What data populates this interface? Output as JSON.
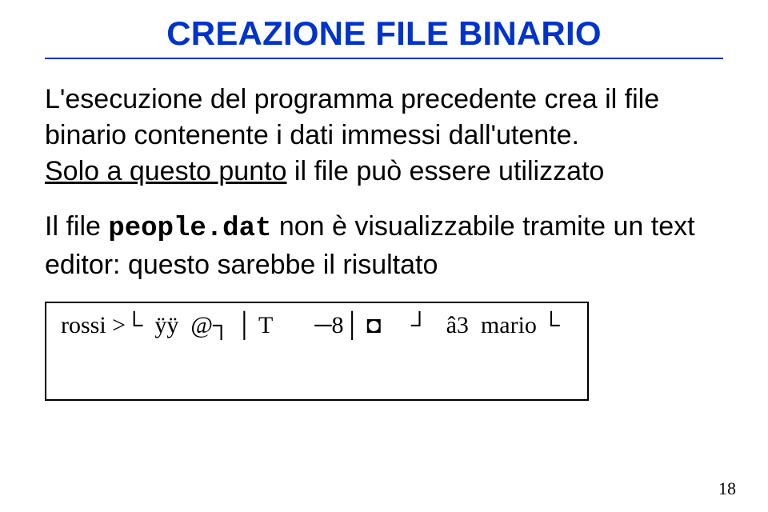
{
  "title": "CREAZIONE FILE BINARIO",
  "p1_a": "L'esecuzione del programma precedente crea il file binario contenente i dati immessi dall'utente. ",
  "p1_u": "Solo a questo punto",
  "p1_b": " il file può essere utilizzato",
  "p2_a": "Il file ",
  "p2_code": "people.dat",
  "p2_b": " non è visualizzabile tramite un text editor: questo sarebbe il risultato",
  "hex": "rossi >└  ÿÿ  @┐ │ T       ─8│ ◘     ┘   â3  mario └",
  "page": "18"
}
